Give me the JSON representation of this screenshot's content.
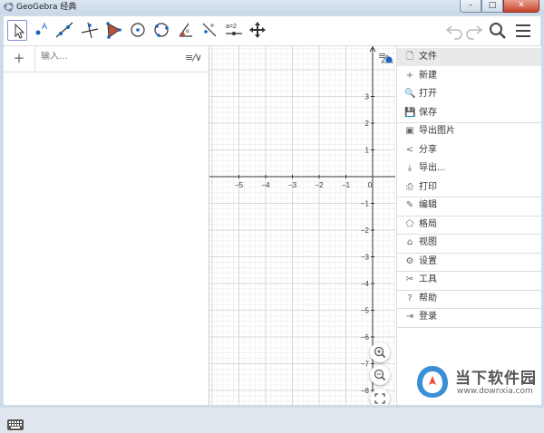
{
  "window": {
    "title": "GeoGebra 经典"
  },
  "toolbar": {
    "tools": [
      "move-tool",
      "point-tool",
      "line-tool",
      "perpendicular-line-tool",
      "polygon-tool",
      "circle-center-point-tool",
      "circle-three-points-tool",
      "angle-tool",
      "reflect-tool",
      "slider-tool",
      "move-graphics-view-tool"
    ],
    "slider_tool_label": "a=2",
    "undo_icon": "undo-icon",
    "redo_icon": "redo-icon",
    "search_icon": "search-icon",
    "menu_icon": "hamburger-menu-icon"
  },
  "algebra": {
    "input_placeholder": "输入...",
    "plus_label": "+"
  },
  "graphics": {
    "x_ticks": [
      "−5",
      "−4",
      "−3",
      "−2",
      "−1",
      "0"
    ],
    "y_ticks_pos": [
      "3",
      "2",
      "1"
    ],
    "y_ticks_neg": [
      "−1",
      "−2",
      "−3",
      "−4",
      "−5",
      "−6",
      "−7",
      "−8"
    ],
    "zoom_in_icon": "zoom-in-icon",
    "zoom_out_icon": "zoom-out-icon",
    "fullscreen_icon": "fullscreen-icon"
  },
  "menu": {
    "items": [
      {
        "icon": "file-icon",
        "glyph": "🗋",
        "label": "文件",
        "header": true
      },
      {
        "icon": "new-icon",
        "glyph": "+",
        "label": "新建"
      },
      {
        "icon": "open-icon",
        "glyph": "🔍",
        "label": "打开"
      },
      {
        "icon": "save-icon",
        "glyph": "💾",
        "label": "保存"
      },
      {
        "icon": "export-image-icon",
        "glyph": "▣",
        "label": "导出图片"
      },
      {
        "icon": "share-icon",
        "glyph": "<",
        "label": "分享"
      },
      {
        "icon": "download-icon",
        "glyph": "⤓",
        "label": "导出..."
      },
      {
        "icon": "print-icon",
        "glyph": "⎙",
        "label": "打印"
      },
      {
        "icon": "edit-icon",
        "glyph": "✎",
        "label": "编辑"
      },
      {
        "icon": "perspectives-icon",
        "glyph": "⬠",
        "label": "格局"
      },
      {
        "icon": "view-icon",
        "glyph": "⌂",
        "label": "视图"
      },
      {
        "icon": "settings-icon",
        "glyph": "⚙",
        "label": "设置"
      },
      {
        "icon": "tools-icon",
        "glyph": "✂",
        "label": "工具"
      },
      {
        "icon": "help-icon",
        "glyph": "?",
        "label": "帮助"
      },
      {
        "icon": "sign-in-icon",
        "glyph": "⇥",
        "label": "登录"
      }
    ]
  },
  "watermark": {
    "name": "当下软件园",
    "url": "www.downxia.com"
  },
  "colors": {
    "selection_border": "#7d8fd6",
    "point_blue": "#1565c0",
    "grid_minor": "#ececec",
    "grid_major": "#d0d0d0"
  }
}
